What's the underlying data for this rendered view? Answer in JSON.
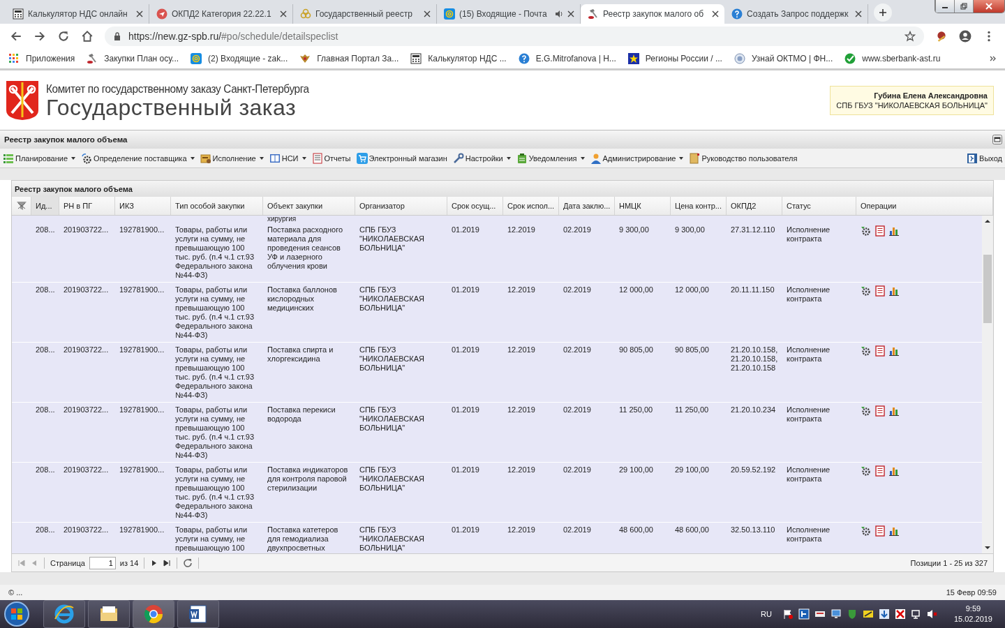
{
  "browser": {
    "tabs": [
      {
        "title": "Калькулятор НДС онлайн",
        "audio": false,
        "selected": false
      },
      {
        "title": "ОКПД2 Категория 22.22.1",
        "audio": false,
        "selected": false
      },
      {
        "title": "Государственный реестр",
        "audio": false,
        "selected": false
      },
      {
        "title": "(15) Входящие - Почта",
        "audio": true,
        "selected": false
      },
      {
        "title": "Реестр закупок малого об",
        "audio": false,
        "selected": true
      },
      {
        "title": "Создать Запрос поддержк",
        "audio": false,
        "selected": false
      }
    ],
    "url_host": "https://new.gz-spb.ru/",
    "url_path": "#po/schedule/detailspeclist",
    "bookmarks": [
      {
        "label": "Приложения"
      },
      {
        "label": "Закупки План осу..."
      },
      {
        "label": "(2) Входящие - zak..."
      },
      {
        "label": "Главная Портал За..."
      },
      {
        "label": "Калькулятор НДС ..."
      },
      {
        "label": "E.G.Mitrofanova | Н..."
      },
      {
        "label": "Регионы России / ..."
      },
      {
        "label": "Узнай ОКТМО | ФН..."
      },
      {
        "label": "www.sberbank-ast.ru"
      }
    ]
  },
  "header": {
    "org_line": "Комитет по государственному заказу Санкт-Петербурга",
    "title": "Государственный заказ",
    "user_name": "Губина Елена Александровна",
    "user_org": "СПБ ГБУЗ \"НИКОЛАЕВСКАЯ БОЛЬНИЦА\""
  },
  "panel_title": "Реестр закупок малого объема",
  "menu": [
    {
      "label": "Планирование",
      "dropdown": true
    },
    {
      "label": "Определение поставщика",
      "dropdown": true
    },
    {
      "label": "Исполнение",
      "dropdown": true
    },
    {
      "label": "НСИ",
      "dropdown": true
    },
    {
      "label": "Отчеты",
      "dropdown": false
    },
    {
      "label": "Электронный магазин",
      "dropdown": false
    },
    {
      "label": "Настройки",
      "dropdown": true
    },
    {
      "label": "Уведомления",
      "dropdown": true
    },
    {
      "label": "Администрирование",
      "dropdown": true
    },
    {
      "label": "Руководство пользователя",
      "dropdown": false
    }
  ],
  "exit_label": "Выход",
  "registry": {
    "title": "Реестр закупок малого объема",
    "columns": [
      "Ид...",
      "РН в ПГ",
      "ИКЗ",
      "Тип особой закупки",
      "Объект закупки",
      "Организатор",
      "Срок осущ...",
      "Срок испол...",
      "Дата заклю...",
      "НМЦК",
      "Цена контр...",
      "ОКПД2",
      "Статус",
      "Операции"
    ],
    "top_fragment": "хирургия",
    "rows": [
      {
        "cells": [
          "208...",
          "201903722...",
          "192781900...",
          "Товары, работы или услуги на сумму, не превышающую 100 тыс. руб. (п.4 ч.1 ст.93 Федерального закона №44-ФЗ)",
          "Поставка расходного материала для проведения сеансов УФ и лазерного облучения крови",
          "СПБ ГБУЗ \"НИКОЛАЕВСКАЯ БОЛЬНИЦА\"",
          "01.2019",
          "12.2019",
          "02.2019",
          "9 300,00",
          "9 300,00",
          "27.31.12.110",
          "Исполнение контракта"
        ]
      },
      {
        "cells": [
          "208...",
          "201903722...",
          "192781900...",
          "Товары, работы или услуги на сумму, не превышающую 100 тыс. руб. (п.4 ч.1 ст.93 Федерального закона №44-ФЗ)",
          "Поставка баллонов кислородных медицинских",
          "СПБ ГБУЗ \"НИКОЛАЕВСКАЯ БОЛЬНИЦА\"",
          "01.2019",
          "12.2019",
          "02.2019",
          "12 000,00",
          "12 000,00",
          "20.11.11.150",
          "Исполнение контракта"
        ]
      },
      {
        "cells": [
          "208...",
          "201903722...",
          "192781900...",
          "Товары, работы или услуги на сумму, не превышающую 100 тыс. руб. (п.4 ч.1 ст.93 Федерального закона №44-ФЗ)",
          "Поставка спирта и хлоргексидина",
          "СПБ ГБУЗ \"НИКОЛАЕВСКАЯ БОЛЬНИЦА\"",
          "01.2019",
          "12.2019",
          "02.2019",
          "90 805,00",
          "90 805,00",
          "21.20.10.158, 21.20.10.158, 21.20.10.158",
          "Исполнение контракта"
        ]
      },
      {
        "cells": [
          "208...",
          "201903722...",
          "192781900...",
          "Товары, работы или услуги на сумму, не превышающую 100 тыс. руб. (п.4 ч.1 ст.93 Федерального закона №44-ФЗ)",
          "Поставка перекиси водорода",
          "СПБ ГБУЗ \"НИКОЛАЕВСКАЯ БОЛЬНИЦА\"",
          "01.2019",
          "12.2019",
          "02.2019",
          "11 250,00",
          "11 250,00",
          "21.20.10.234",
          "Исполнение контракта"
        ]
      },
      {
        "cells": [
          "208...",
          "201903722...",
          "192781900...",
          "Товары, работы или услуги на сумму, не превышающую 100 тыс. руб. (п.4 ч.1 ст.93 Федерального закона №44-ФЗ)",
          "Поставка индикаторов для контроля паровой стерилизации",
          "СПБ ГБУЗ \"НИКОЛАЕВСКАЯ БОЛЬНИЦА\"",
          "01.2019",
          "12.2019",
          "02.2019",
          "29 100,00",
          "29 100,00",
          "20.59.52.192",
          "Исполнение контракта"
        ]
      },
      {
        "cells": [
          "208...",
          "201903722...",
          "192781900...",
          "Товары, работы или услуги на сумму, не превышающую 100",
          "Поставка катетеров для гемодиализа двухпросветных",
          "СПБ ГБУЗ \"НИКОЛАЕВСКАЯ БОЛЬНИЦА\"",
          "01.2019",
          "12.2019",
          "02.2019",
          "48 600,00",
          "48 600,00",
          "32.50.13.110",
          "Исполнение контракта"
        ]
      }
    ],
    "pager": {
      "page_label": "Страница",
      "page": "1",
      "of_label": "из 14",
      "positions": "Позиции 1 - 25 из 327"
    }
  },
  "footer": {
    "copyright": "© ...",
    "datetime": "15 Февр 09:59"
  },
  "taskbar": {
    "lang": "RU",
    "time": "9:59",
    "date": "15.02.2019"
  }
}
